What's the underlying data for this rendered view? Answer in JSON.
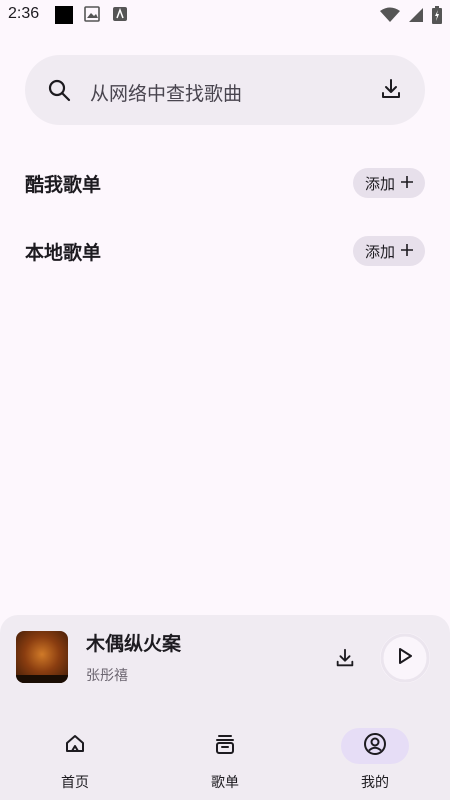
{
  "status_bar": {
    "time": "2:36"
  },
  "search": {
    "placeholder": "从网络中查找歌曲"
  },
  "playlists": [
    {
      "title": "酷我歌单",
      "add_label": "添加"
    },
    {
      "title": "本地歌单",
      "add_label": "添加"
    }
  ],
  "player": {
    "song_title": "木偶纵火案",
    "artist": "张彤禧",
    "album_art_text": "木偶纵火案"
  },
  "nav": [
    {
      "label": "首页",
      "icon": "home-icon",
      "active": false
    },
    {
      "label": "歌单",
      "icon": "playlist-icon",
      "active": false
    },
    {
      "label": "我的",
      "icon": "profile-icon",
      "active": true
    }
  ],
  "colors": {
    "background": "#fdf7fd",
    "surface": "#f0ebf2",
    "chip": "#e7e0eb",
    "active_indicator": "#e6ddf6"
  }
}
